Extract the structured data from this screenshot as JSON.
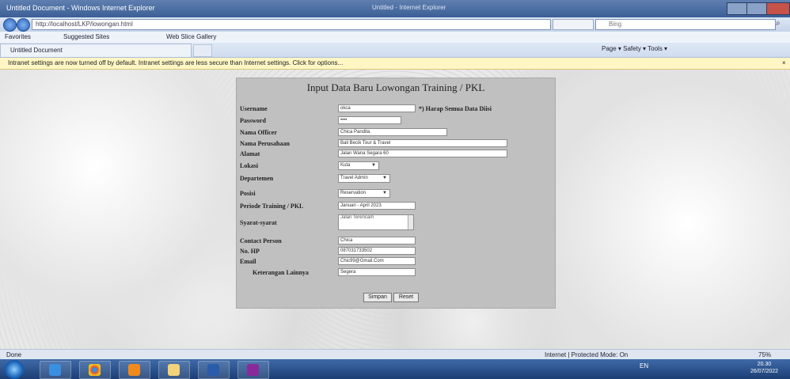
{
  "window": {
    "title": "Untitled Document - Windows Internet Explorer",
    "title_center": "Untitled - Internet Explorer"
  },
  "address": {
    "url": "http://localhost/LKP/lowongan.html",
    "search_placeholder": "Bing"
  },
  "favorites": {
    "favorites_label": "Favorites",
    "suggested_label": "Suggested Sites",
    "webslice_label": "Web Slice Gallery"
  },
  "tabs": [
    {
      "label": "Untitled Document"
    }
  ],
  "command_bar": "Page ▾   Safety ▾   Tools ▾",
  "info_bar": "Intranet settings are now turned off by default. Intranet settings are less secure than Internet settings. Click for options...",
  "form": {
    "title": "Input Data Baru Lowongan Training / PKL",
    "note": "*) Harap Semua Data Diisi",
    "fields": {
      "username": {
        "label": "Username",
        "value": "okca"
      },
      "password": {
        "label": "Password",
        "value": "••••"
      },
      "nama_officer": {
        "label": "Nama Officer",
        "value": "Chica Pandita"
      },
      "nama_perusahaan": {
        "label": "Nama Perusahaan",
        "value": "Bali Becik Tour & Travel"
      },
      "alamat": {
        "label": "Alamat",
        "value": "Jalan Wana Segara 60"
      },
      "lokasi": {
        "label": "Lokasi",
        "value": "Kuta"
      },
      "departemen": {
        "label": "Departemen",
        "value": "Travel Admin"
      },
      "posisi": {
        "label": "Posisi",
        "value": "Reservation"
      },
      "periode": {
        "label": "Periode Training / PKL",
        "value": "Januari - April 2023"
      },
      "syarat": {
        "label": "Syarat-syarat",
        "value": "Jalan Terencam"
      },
      "contact_person": {
        "label": "Contact Person",
        "value": "Chica"
      },
      "no_hp": {
        "label": "No. HP",
        "value": "087031733502"
      },
      "email": {
        "label": "Email",
        "value": "Chic99@Gmail.Com"
      },
      "keterangan": {
        "label": "Keterangan Lainnya",
        "value": "Segera"
      }
    },
    "buttons": {
      "simpan": "Simpan",
      "reset": "Reset"
    }
  },
  "status_bar": {
    "left": "Done",
    "zone": "Internet | Protected Mode: On",
    "zoom": "75%"
  },
  "taskbar": {
    "tray": "EN",
    "time": "20.30",
    "date": "26/07/2022"
  }
}
